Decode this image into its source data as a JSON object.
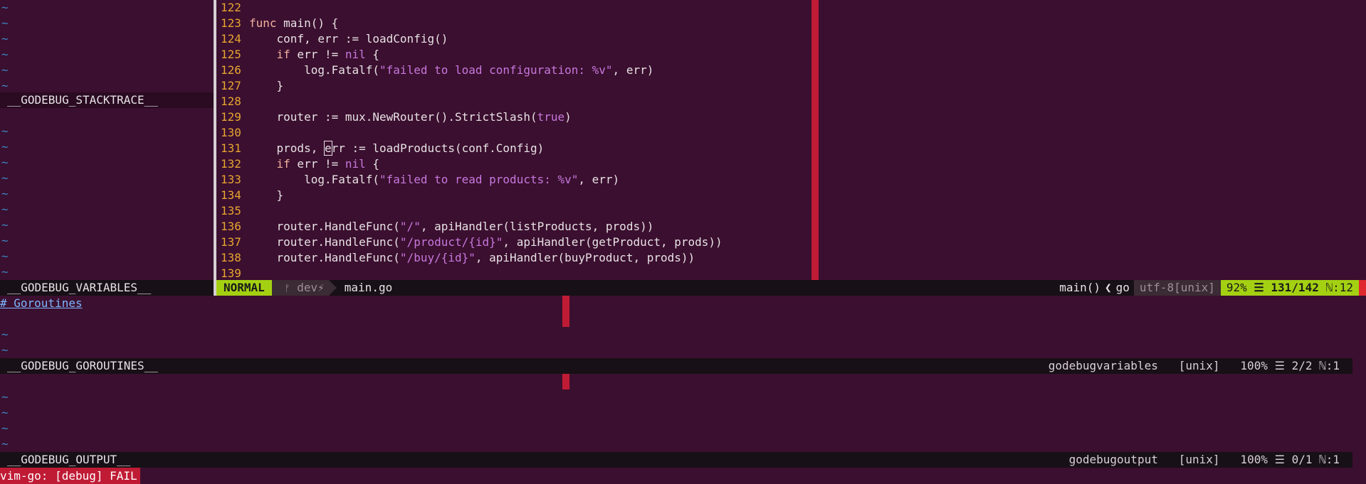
{
  "colors": {
    "background": "#3b0f2f",
    "accent": "#a4d012",
    "error": "#c01b35",
    "line_number": "#e6a530"
  },
  "panes": {
    "stacktrace_label": "__GODEBUG_STACKTRACE__",
    "variables_label": "__GODEBUG_VARIABLES__",
    "goroutines_label": "__GODEBUG_GOROUTINES__",
    "output_label": "__GODEBUG_OUTPUT__"
  },
  "code": {
    "lines": [
      {
        "n": "122",
        "t": ""
      },
      {
        "n": "123",
        "t": "func main() {"
      },
      {
        "n": "124",
        "t": "    conf, err := loadConfig()"
      },
      {
        "n": "125",
        "t": "    if err != nil {"
      },
      {
        "n": "126",
        "t": "        log.Fatalf(\"failed to load configuration: %v\", err)"
      },
      {
        "n": "127",
        "t": "    }"
      },
      {
        "n": "128",
        "t": ""
      },
      {
        "n": "129",
        "t": "    router := mux.NewRouter().StrictSlash(true)"
      },
      {
        "n": "130",
        "t": ""
      },
      {
        "n": "131",
        "t": "    prods, err := loadProducts(conf.Config)"
      },
      {
        "n": "132",
        "t": "    if err != nil {"
      },
      {
        "n": "133",
        "t": "        log.Fatalf(\"failed to read products: %v\", err)"
      },
      {
        "n": "134",
        "t": "    }"
      },
      {
        "n": "135",
        "t": ""
      },
      {
        "n": "136",
        "t": "    router.HandleFunc(\"/\", apiHandler(listProducts, prods))"
      },
      {
        "n": "137",
        "t": "    router.HandleFunc(\"/product/{id}\", apiHandler(getProduct, prods))"
      },
      {
        "n": "138",
        "t": "    router.HandleFunc(\"/buy/{id}\", apiHandler(buyProduct, prods))"
      },
      {
        "n": "139",
        "t": ""
      }
    ]
  },
  "statusline": {
    "mode": "NORMAL",
    "branch_icon": "git-branch-icon",
    "branch": "dev⚡",
    "filename": "main.go",
    "function": "main()",
    "filetype_sep": "❮",
    "filetype": "go",
    "encoding": "utf-8[unix]",
    "percent": "92%",
    "position": "☰ 131/142",
    "column": "ℕ:12"
  },
  "goroutines": {
    "header": "# Goroutines",
    "status_right": "godebugvariables   [unix]   100% ☰ 2/2 ℕ:1"
  },
  "output": {
    "status_right": "godebugoutput   [unix]   100% ☰ 0/1 ℕ:1"
  },
  "message": "vim-go: [debug] FAIL",
  "tilde": "~"
}
